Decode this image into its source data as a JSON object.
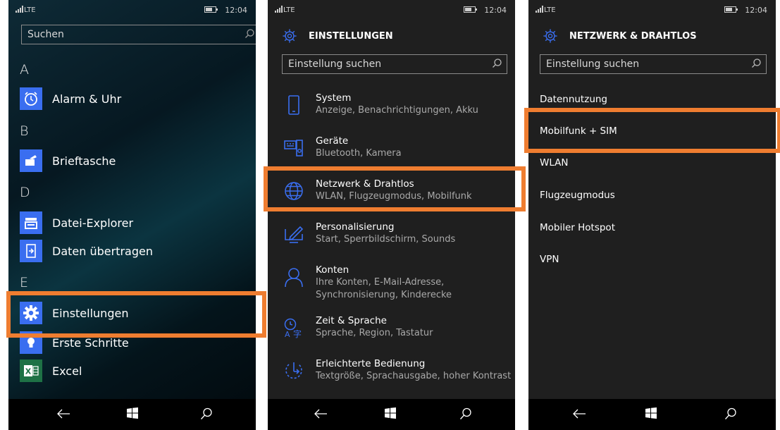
{
  "status": {
    "network": "LTE",
    "time": "12:04"
  },
  "screen1": {
    "search_placeholder": "Suchen",
    "sections": [
      {
        "letter": "A",
        "apps": [
          {
            "label": "Alarm & Uhr",
            "icon": "alarm-clock-icon"
          }
        ]
      },
      {
        "letter": "B",
        "apps": [
          {
            "label": "Brieftasche",
            "icon": "wallet-icon"
          }
        ]
      },
      {
        "letter": "D",
        "apps": [
          {
            "label": "Datei-Explorer",
            "icon": "file-explorer-icon"
          },
          {
            "label": "Daten übertragen",
            "icon": "transfer-data-icon"
          }
        ]
      },
      {
        "letter": "E",
        "apps": [
          {
            "label": "Einstellungen",
            "icon": "gear-icon"
          },
          {
            "label": "Erste Schritte",
            "icon": "lightbulb-icon"
          },
          {
            "label": "Excel",
            "icon": "excel-icon"
          }
        ]
      }
    ]
  },
  "screen2": {
    "title": "EINSTELLUNGEN",
    "search_placeholder": "Einstellung suchen",
    "items": [
      {
        "title": "System",
        "subtitle": "Anzeige, Benachrichtigungen, Akku",
        "icon": "phone-icon"
      },
      {
        "title": "Geräte",
        "subtitle": "Bluetooth, Kamera",
        "icon": "devices-icon"
      },
      {
        "title": "Netzwerk & Drahtlos",
        "subtitle": "WLAN, Flugzeugmodus, Mobilfunk",
        "icon": "globe-icon"
      },
      {
        "title": "Personalisierung",
        "subtitle": "Start, Sperrbildschirm, Sounds",
        "icon": "personalize-icon"
      },
      {
        "title": "Konten",
        "subtitle": "Ihre Konten, E-Mail-Adresse,",
        "subtitle2": "Synchronisierung, Kinderecke",
        "icon": "person-icon"
      },
      {
        "title": "Zeit & Sprache",
        "subtitle": "Sprache, Region, Tastatur",
        "icon": "time-language-icon"
      },
      {
        "title": "Erleichterte Bedienung",
        "subtitle": "Textgröße, Sprachausgabe, hoher Kontrast",
        "icon": "ease-of-access-icon"
      }
    ]
  },
  "screen3": {
    "title": "NETZWERK & DRAHTLOS",
    "search_placeholder": "Einstellung suchen",
    "items": [
      "Datennutzung",
      "Mobilfunk + SIM",
      "WLAN",
      "Flugzeugmodus",
      "Mobiler Hotspot",
      "VPN"
    ]
  },
  "colors": {
    "highlight": "#ef7d30",
    "accent": "#3a6ef0",
    "settings_bg": "#1f1f1f",
    "taskbar": "#000000"
  },
  "taskbar_icons": [
    "back-arrow-icon",
    "windows-icon",
    "search-icon"
  ]
}
